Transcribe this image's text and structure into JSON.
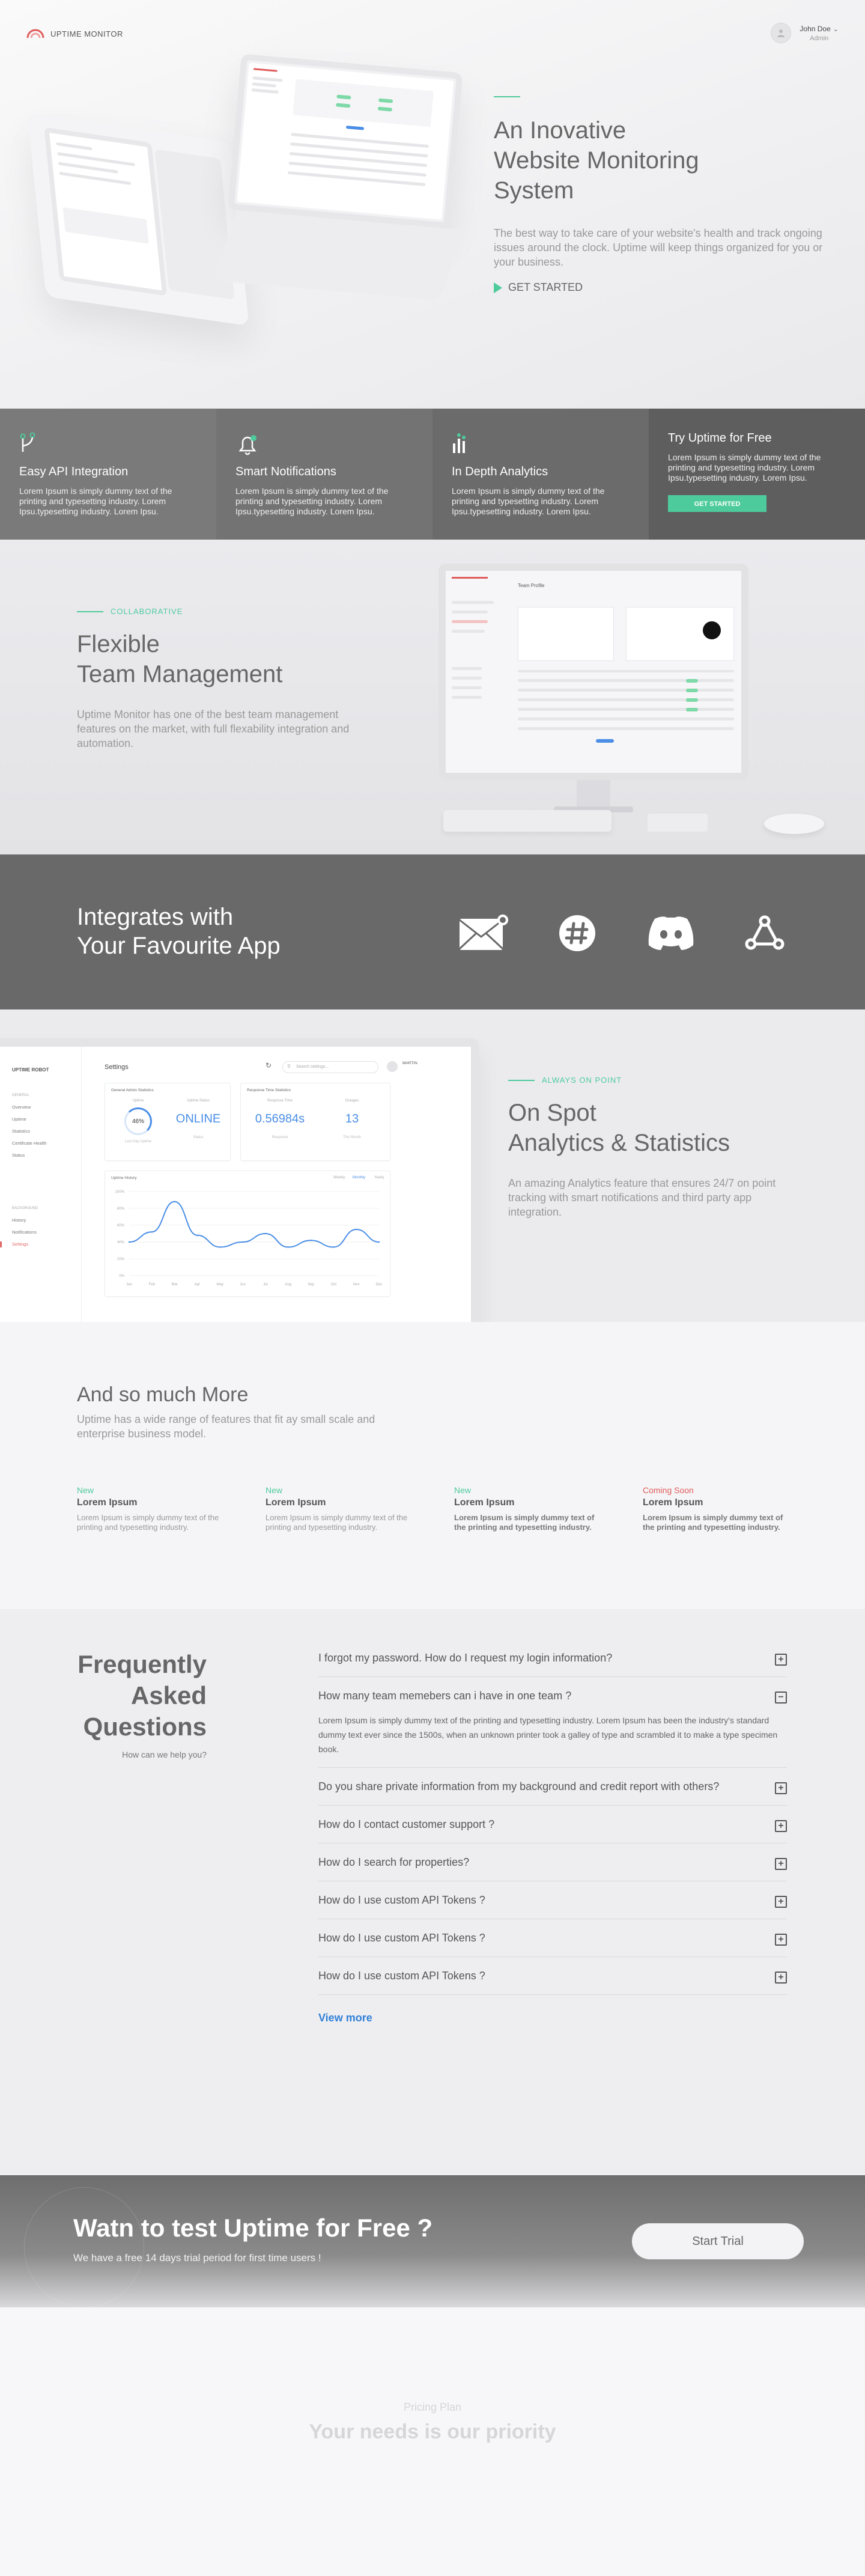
{
  "header": {
    "logo_text": "UPTIME MONITOR",
    "user_name": "John Doe",
    "user_role": "Admin"
  },
  "hero": {
    "title_line1": "An Inovative",
    "title_line2": "Website Monitoring",
    "title_line3": "System",
    "description": "The best way to take care of your website's health and track ongoing issues around the clock. Uptime will keep things organized for you or your business.",
    "cta": "GET STARTED"
  },
  "features": [
    {
      "title": "Easy API Integration",
      "text": "Lorem Ipsum is simply dummy text of the printing and typesetting industry. Lorem Ipsu.typesetting industry. Lorem Ipsu.",
      "icon": "api-icon",
      "bg": "#7a7a7a"
    },
    {
      "title": "Smart Notifications",
      "text": "Lorem Ipsum is simply dummy text of the printing and typesetting industry. Lorem Ipsu.typesetting industry. Lorem Ipsu.",
      "icon": "bell-icon",
      "bg": "#737373"
    },
    {
      "title": "In Depth Analytics",
      "text": "Lorem Ipsum is simply dummy text of the printing and typesetting industry. Lorem Ipsu.typesetting industry. Lorem Ipsu.",
      "icon": "bar-chart-icon",
      "bg": "#6b6b6b"
    },
    {
      "title": "Try Uptime for Free",
      "text": "Lorem Ipsum is simply dummy text of the printing and typesetting industry. Lorem Ipsu.typesetting industry. Lorem Ipsu.",
      "button": "GET STARTED",
      "bg": "#5e5e5e"
    }
  ],
  "team": {
    "eyebrow": "COLLABORATIVE",
    "title_line1": "Flexible",
    "title_line2": "Team Management",
    "description": "Uptime Monitor has one of the best team management features on the market, with full flexability integration and automation.",
    "screen_title": "Team Profile"
  },
  "integrations": {
    "title_line1": "Integrates with",
    "title_line2": "Your Favourite App",
    "apps": [
      "mail-icon",
      "slack-icon",
      "discord-icon",
      "webhook-icon"
    ]
  },
  "analytics": {
    "eyebrow": "ALWAYS ON POINT",
    "title_line1": "On Spot",
    "title_line2": "Analytics & Statistics",
    "description": "An amazing Analytics feature that ensures 24/7 on point tracking with smart notifications and third party app integration.",
    "app": {
      "brand": "UPTIME ROBOT",
      "page_title": "Settings",
      "search_placeholder": "Search settings...",
      "user": "MARTIN",
      "general_label": "GENERAL",
      "background_label": "BACKGROUND",
      "nav_general": [
        "Overview",
        "Uptime",
        "Statistics",
        "Certificate Health",
        "Status"
      ],
      "nav_background": [
        "History",
        "Notifications",
        "Settings"
      ],
      "general_card": "General Admin Statistics",
      "response_card": "Response Time Statistics",
      "uptime_label": "Uptime",
      "uptime_value": "46%",
      "uptime_sub": "Last Day Uptime",
      "status_label": "Uptime Status",
      "status_value": "ONLINE",
      "status_sub": "Status",
      "response_label": "Response Time",
      "response_value": "0.56984s",
      "response_sub": "Response",
      "outages_label": "Outages",
      "outages_value": "13",
      "outages_sub": "This Month",
      "chart_title": "Uptime History",
      "ranges": [
        "Weekly",
        "Monthly",
        "Yearly"
      ]
    }
  },
  "chart_data": {
    "type": "line",
    "title": "Uptime History",
    "categories": [
      "Jan",
      "Feb",
      "Mar",
      "Apr",
      "May",
      "Jun",
      "Jul",
      "Aug",
      "Sep",
      "Oct",
      "Nov",
      "Dec"
    ],
    "values": [
      40,
      52,
      88,
      48,
      34,
      40,
      50,
      34,
      42,
      34,
      55,
      40
    ],
    "ylim": [
      0,
      100
    ],
    "yticks": [
      "100%",
      "80%",
      "60%",
      "40%",
      "20%",
      "0%"
    ],
    "color": "#4a8ee6"
  },
  "more": {
    "title": "And so much More",
    "description": "Uptime has a wide range of features that fit ay small scale and enterprise business model.",
    "items": [
      {
        "tag": "New",
        "title": "Lorem Ipsum",
        "text": "Lorem Ipsum is simply dummy text of the printing and typesetting industry.",
        "status": "new"
      },
      {
        "tag": "New",
        "title": "Lorem Ipsum",
        "text": "Lorem Ipsum is simply dummy text of the printing and typesetting industry.",
        "status": "new"
      },
      {
        "tag": "New",
        "title": "Lorem Ipsum",
        "text": "Lorem Ipsum is simply dummy text of the printing and typesetting industry.",
        "status": "new"
      },
      {
        "tag": "Coming Soon",
        "title": "Lorem Ipsum",
        "text": "Lorem Ipsum is simply dummy text of the printing and typesetting industry.",
        "status": "soon"
      }
    ]
  },
  "faq": {
    "title_line1": "Frequently",
    "title_line2": "Asked",
    "title_line3": "Questions",
    "subtitle": "How can we help you?",
    "items": [
      {
        "q": "I forgot my password. How do I request my login information?",
        "open": false
      },
      {
        "q": "How many team memebers can i have  in one team ?",
        "open": true,
        "a": "Lorem Ipsum is simply dummy text of the printing and typesetting industry. Lorem Ipsum has been the industry's standard dummy text ever since the 1500s, when an unknown printer took a galley of type and scrambled it to make a type specimen book."
      },
      {
        "q": "Do you share private information from my background and credit report with others?",
        "open": false
      },
      {
        "q": "How do I contact customer support ?",
        "open": false
      },
      {
        "q": "How do I search for properties?",
        "open": false
      },
      {
        "q": "How do I use custom API Tokens ?",
        "open": false
      },
      {
        "q": "How do I use custom API Tokens ?",
        "open": false
      },
      {
        "q": "How do I use custom API Tokens ?",
        "open": false
      }
    ],
    "view_more": "View more"
  },
  "trial": {
    "title": "Watn to test Uptime for Free ?",
    "subtitle": "We have a free 14 days trial period for first time users !",
    "button": "Start Trial"
  },
  "pricing": {
    "label": "Pricing Plan",
    "title": "Your needs is our priority"
  },
  "colors": {
    "accent": "#4ecb9c",
    "link": "#2f7fd8",
    "brand_red": "#e05b5b",
    "chart_blue": "#4a8ee6"
  }
}
